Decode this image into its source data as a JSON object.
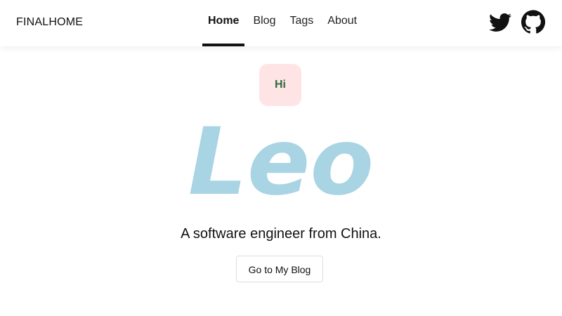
{
  "header": {
    "brand": "FINALHOME",
    "nav": [
      {
        "label": "Home",
        "active": true
      },
      {
        "label": "Blog",
        "active": false
      },
      {
        "label": "Tags",
        "active": false
      },
      {
        "label": "About",
        "active": false
      }
    ],
    "social_icons": [
      "twitter-icon",
      "github-icon"
    ]
  },
  "hero": {
    "badge": "Hi",
    "name": "Leo",
    "tagline": "A software engineer from China.",
    "cta_label": "Go to My Blog"
  },
  "colors": {
    "badge_bg": "#ffe4e6",
    "badge_text": "#2f6b3f",
    "name": "#a8d4e3",
    "active_underline": "#111111"
  }
}
